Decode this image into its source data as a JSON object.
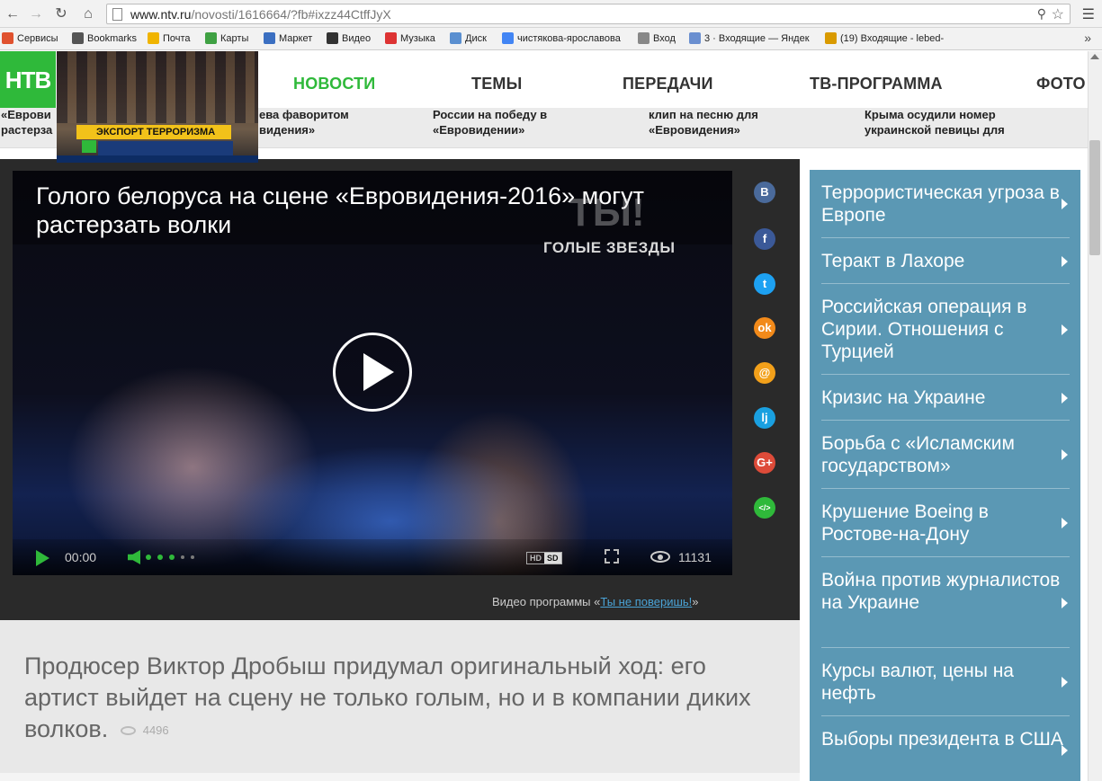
{
  "browser": {
    "url_host": "www.ntv.ru",
    "url_path": "/novosti/1616664/?fb#ixzz44CtffJyX",
    "bookmarks": [
      {
        "label": "Сервисы",
        "icon": "apps-grid-icon",
        "color": "#e0522f"
      },
      {
        "label": "Bookmarks",
        "icon": "star-icon",
        "color": "#555555"
      },
      {
        "label": "Почта",
        "icon": "mail-icon",
        "color": "#f0b400"
      },
      {
        "label": "Карты",
        "icon": "maps-icon",
        "color": "#3fa143"
      },
      {
        "label": "Маркет",
        "icon": "market-icon",
        "color": "#3b6fc1"
      },
      {
        "label": "Видео",
        "icon": "video-icon",
        "color": "#333333"
      },
      {
        "label": "Музыка",
        "icon": "music-icon",
        "color": "#d33"
      },
      {
        "label": "Диск",
        "icon": "disk-icon",
        "color": "#5a8fd0"
      },
      {
        "label": "чистякова-ярославова",
        "icon": "google-icon",
        "color": "#4285f4"
      },
      {
        "label": "Вход",
        "icon": "page-icon",
        "color": "#888888"
      },
      {
        "label": "3 · Входящие — Яндек",
        "icon": "yandex-mail-icon",
        "color": "#6a8fd0"
      },
      {
        "label": "(19) Входящие - lebed-",
        "icon": "mail-ru-icon",
        "color": "#d99a00"
      }
    ]
  },
  "site": {
    "logo": "НТВ",
    "thumb_caption": "ЭКСПОРТ ТЕРРОРИЗМА",
    "menu": [
      {
        "label": "НОВОСТИ",
        "active": true
      },
      {
        "label": "ТЕМЫ",
        "active": false
      },
      {
        "label": "ПЕРЕДАЧИ",
        "active": false
      },
      {
        "label": "ТВ-ПРОГРАММА",
        "active": false
      },
      {
        "label": "ФОТО",
        "active": false
      }
    ],
    "news_strip": [
      "«Еврови растерза",
      "ева фаворитом видения»",
      "России на победу в «Евровидении»",
      "клип на песню для «Евровидения»",
      "Крыма осудили номер украинской певицы для"
    ],
    "accent_color": "#2fb93a",
    "sidebar_color": "#5b98b4"
  },
  "video": {
    "title": "Голого белоруса на сцене «Евровидения-2016» могут растерзать волки",
    "show_logo": "ГОЛЫЕ ЗВЕЗДЫ",
    "show_watermark": "ТЫ!",
    "time": "00:00",
    "hd": "HD",
    "sd": "SD",
    "views": "11131",
    "volume_level": 0.6,
    "program_prefix": "Видео программы «",
    "program_link": "Ты не поверишь!",
    "program_suffix": "»"
  },
  "share": [
    {
      "label": "В",
      "icon": "vk-icon",
      "color": "#4a6a9b"
    },
    {
      "label": "f",
      "icon": "facebook-icon",
      "color": "#3b5998"
    },
    {
      "label": "t",
      "icon": "twitter-icon",
      "color": "#1da1f2"
    },
    {
      "label": "ok",
      "icon": "odnoklassniki-icon",
      "color": "#f28a1a"
    },
    {
      "label": "@",
      "icon": "mailru-icon",
      "color": "#f2a01a"
    },
    {
      "label": "lj",
      "icon": "livejournal-icon",
      "color": "#1aa0e0"
    },
    {
      "label": "G+",
      "icon": "google-plus-icon",
      "color": "#dd4b39"
    },
    {
      "label": "</>",
      "icon": "embed-icon",
      "color": "#2fb93a"
    }
  ],
  "article": {
    "lead": "Продюсер Виктор Дробыш придумал оригинальный ход: его артист выйдет на сцену не только голым, но и в компании диких волков.",
    "views": "4496"
  },
  "topics": [
    "Террористическая угроза в Европе",
    "Теракт в Лахоре",
    "Российская операция в Сирии. Отношения с Турцией",
    "Кризис на Украине",
    "Борьба с «Исламским государством»",
    "Крушение Boeing в Ростове-на-Дону",
    "Война против журналистов на Украине",
    "Курсы валют, цены на нефть",
    "Выборы президента в США"
  ]
}
